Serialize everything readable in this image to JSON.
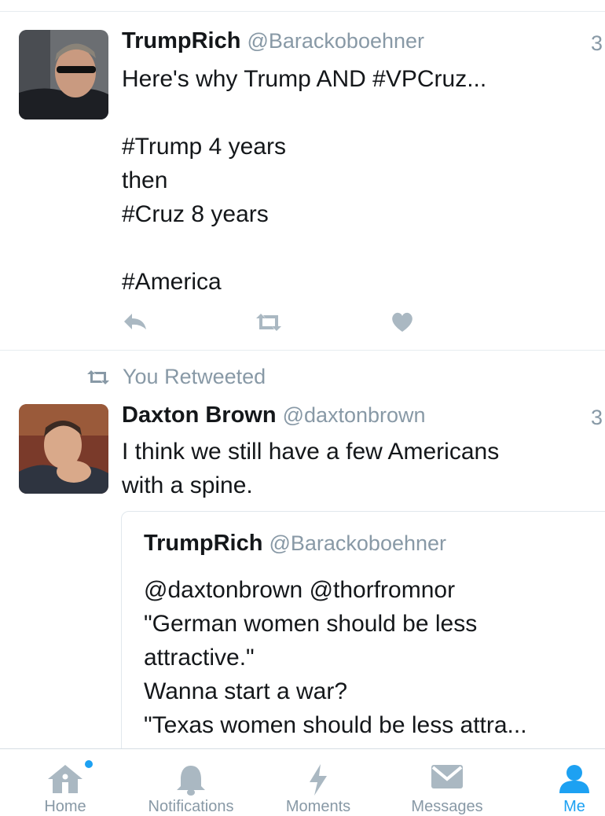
{
  "tweets": [
    {
      "name": "TrumpRich",
      "handle": "@Barackoboehner",
      "time": "3",
      "text": "Here's why Trump AND #VPCruz...\n\n#Trump 4 years\nthen\n#Cruz 8 years\n\n#America"
    },
    {
      "retweet_note": "You Retweeted",
      "name": "Daxton Brown",
      "handle": "@daxtonbrown",
      "time": "3",
      "text": "I think we still have a few Americans\nwith a spine.",
      "quoted": {
        "name": "TrumpRich",
        "handle": "@Barackoboehner",
        "text": "@daxtonbrown @thorfromnor\n\"German women should be less\nattractive.\"\nWanna start a war?\n\"Texas women should be less attra..."
      }
    }
  ],
  "tabbar": {
    "tabs": [
      {
        "label": "Home",
        "icon": "home-icon"
      },
      {
        "label": "Notifications",
        "icon": "bell-icon"
      },
      {
        "label": "Moments",
        "icon": "lightning-icon"
      },
      {
        "label": "Messages",
        "icon": "envelope-icon"
      },
      {
        "label": "Me",
        "icon": "person-icon",
        "active": true
      }
    ]
  },
  "colors": {
    "accent": "#1da1f2",
    "muted": "#8899a6",
    "icon_gray": "#aab8c2",
    "divider": "#e6ecf0"
  }
}
